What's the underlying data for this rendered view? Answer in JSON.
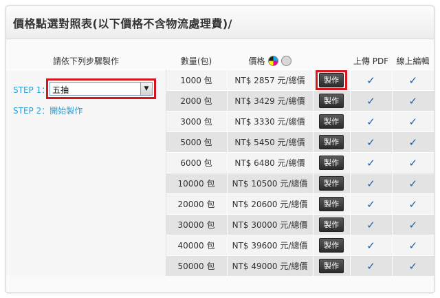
{
  "panel": {
    "title": "價格點選對照表(以下價格不含物流處理費)/"
  },
  "table": {
    "headers": {
      "steps": "請依下列步驟製作",
      "quantity": "數量(包)",
      "price": "價格",
      "upload": "上傳 PDF",
      "online_edit": "線上編輯"
    },
    "price_icons": [
      "color-cmyk-icon",
      "grayscale-icon"
    ],
    "rows": [
      {
        "qty": "1000 包",
        "price": "NT$ 2857 元/總價",
        "make": "製作"
      },
      {
        "qty": "2000 包",
        "price": "NT$ 3429 元/總價",
        "make": "製作"
      },
      {
        "qty": "3000 包",
        "price": "NT$ 3330 元/總價",
        "make": "製作"
      },
      {
        "qty": "5000 包",
        "price": "NT$ 5450 元/總價",
        "make": "製作"
      },
      {
        "qty": "6000 包",
        "price": "NT$ 6480 元/總價",
        "make": "製作"
      },
      {
        "qty": "10000 包",
        "price": "NT$ 10500 元/總價",
        "make": "製作"
      },
      {
        "qty": "20000 包",
        "price": "NT$ 20600 元/總價",
        "make": "製作"
      },
      {
        "qty": "30000 包",
        "price": "NT$ 30000 元/總價",
        "make": "製作"
      },
      {
        "qty": "40000 包",
        "price": "NT$ 39600 元/總價",
        "make": "製作"
      },
      {
        "qty": "50000 包",
        "price": "NT$ 49000 元/總價",
        "make": "製作"
      }
    ],
    "check_mark": "✓"
  },
  "steps": {
    "step1_label": "STEP 1：",
    "select_value": "五抽",
    "step2_label": "STEP 2：",
    "step2_link": "開始製作"
  },
  "colors": {
    "accent": "#2a9fd6",
    "highlight": "#d6141d",
    "check": "#1a5fa8"
  }
}
